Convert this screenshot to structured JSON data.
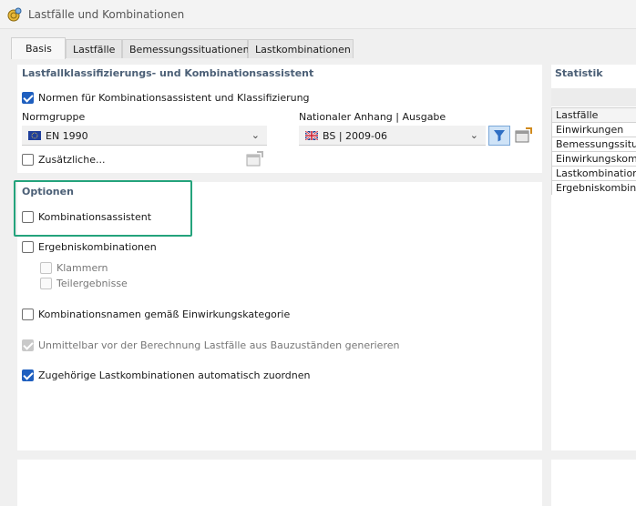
{
  "window": {
    "title": "Lastfälle und Kombinationen",
    "icon": "app-coin-icon"
  },
  "tabs": [
    {
      "label": "Basis",
      "active": true
    },
    {
      "label": "Lastfälle",
      "active": false
    },
    {
      "label": "Bemessungssituationen",
      "active": false
    },
    {
      "label": "Lastkombinationen",
      "active": false
    }
  ],
  "assistant": {
    "title": "Lastfallklassifizierungs- und Kombinationsassistent",
    "norms_checkbox": {
      "label": "Normen für Kombinationsassistent und Klassifizierung",
      "checked": true
    },
    "normgruppe": {
      "label": "Normgruppe",
      "value": "EN 1990",
      "flag_icon": "eu-flag-icon"
    },
    "annex": {
      "label": "Nationaler Anhang | Ausgabe",
      "value": "BS | 2009-06",
      "flag_icon": "uk-flag-icon"
    },
    "additional_checkbox": {
      "label": "Zusätzliche...",
      "checked": false
    }
  },
  "options": {
    "title": "Optionen",
    "kombinationsassistent": {
      "label": "Kombinationsassistent",
      "checked": false
    },
    "ergebniskombinationen": {
      "label": "Ergebniskombinationen",
      "checked": false
    },
    "klammern": {
      "label": "Klammern",
      "checked": false,
      "disabled": true
    },
    "teilergebnisse": {
      "label": "Teilergebnisse",
      "checked": false,
      "disabled": true
    },
    "kombinationsnamen": {
      "label": "Kombinationsnamen gemäß Einwirkungskategorie",
      "checked": false
    },
    "bauzustaende": {
      "label": "Unmittelbar vor der Berechnung Lastfälle aus Bauzuständen generieren",
      "checked": true,
      "disabled": true
    },
    "zuordnen": {
      "label": "Zugehörige Lastkombinationen automatisch zuordnen",
      "checked": true
    }
  },
  "statistik": {
    "title": "Statistik",
    "rows": [
      "Lastfälle",
      "Einwirkungen",
      "Bemessungssituationen",
      "Einwirkungskombinationen",
      "Lastkombinationen",
      "Ergebniskombinationen"
    ]
  },
  "colors": {
    "accent": "#1f5fbf",
    "highlight": "#24a37c",
    "section_title": "#4b5f76"
  }
}
